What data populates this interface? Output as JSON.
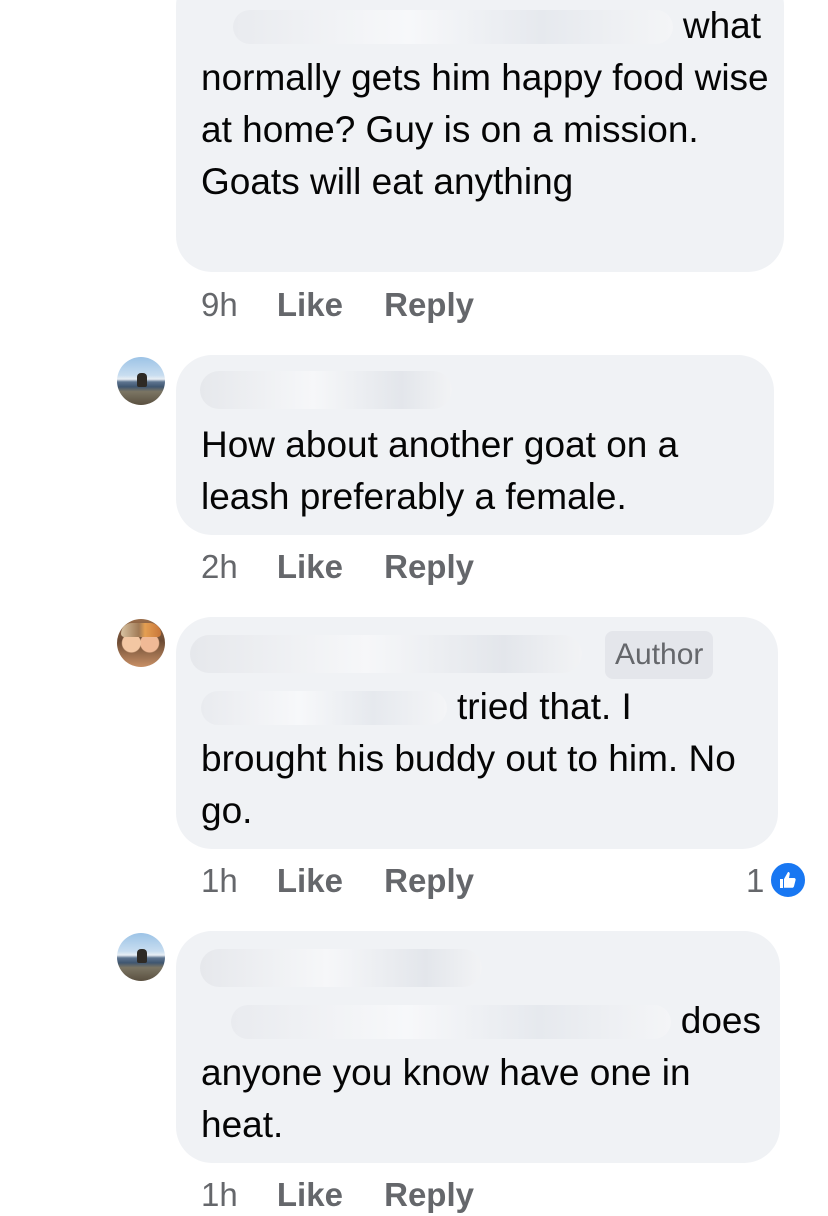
{
  "comments": [
    {
      "text_first_line_end": "what",
      "text_rest": "normally gets him happy food wise at home? Guy is on a mission. Goats will eat anything",
      "time": "9h",
      "like_label": "Like",
      "reply_label": "Reply"
    },
    {
      "text": "How about another goat on a leash preferably a female.",
      "time": "2h",
      "like_label": "Like",
      "reply_label": "Reply"
    },
    {
      "badge": "Author",
      "text_first_line_end": "tried that. I",
      "text_rest": "brought his buddy out to him. No go.",
      "time": "1h",
      "like_label": "Like",
      "reply_label": "Reply",
      "reaction_count": "1"
    },
    {
      "text_first_line_end": "does",
      "text_rest": "anyone you know have one in heat.",
      "time": "1h",
      "like_label": "Like",
      "reply_label": "Reply"
    }
  ],
  "colors": {
    "bubble": "#f0f2f5",
    "meta_text": "#65676b",
    "like_blue": "#1877f2"
  }
}
